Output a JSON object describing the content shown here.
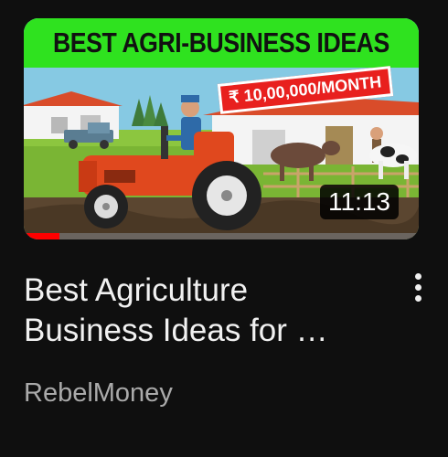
{
  "video": {
    "thumbnail_banner": "BEST AGRI-BUSINESS IDEAS",
    "thumbnail_price_tag": "₹ 10,00,000/MONTH",
    "duration": "11:13",
    "watch_progress": 0.09,
    "title_line1": "Best Agriculture",
    "title_line2": "Business Ideas for …",
    "channel": "RebelMoney"
  },
  "icons": {
    "more": "more-vert-icon"
  },
  "colors": {
    "background": "#0f0f0f",
    "banner": "#2fe21f",
    "price_tag": "#e8201e",
    "progress": "#ff0000",
    "title_text": "#f1f1f1",
    "channel_text": "#aaaaaa"
  }
}
